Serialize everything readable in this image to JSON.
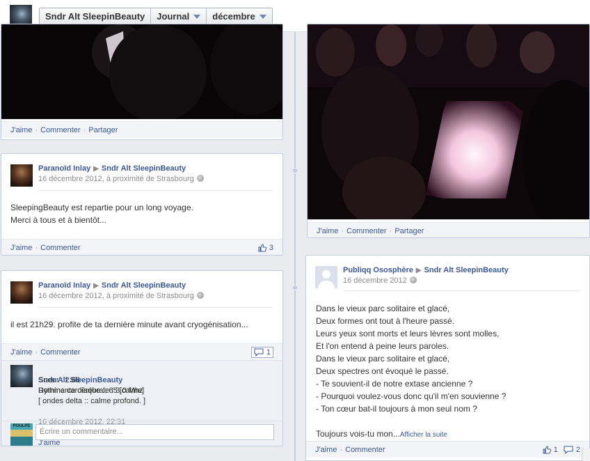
{
  "header": {
    "page_name": "Sndr Alt SleepinBeauty",
    "section": "Journal",
    "month": "décembre"
  },
  "actions": {
    "like": "J'aime",
    "comment": "Commenter",
    "share": "Partager",
    "sep": "·"
  },
  "left_photo_post": {},
  "post1": {
    "author": "Paranoïd Inlay",
    "target": "Sndr Alt SleepinBeauty",
    "date": "16 décembre 2012, à proximité de Strasbourg",
    "text": "SleepingBeauty est repartie pour un long voyage.\nMerci à tous et à bientôt...",
    "likes": "3"
  },
  "post2": {
    "author": "Paranoïd Inlay",
    "target": "Sndr Alt SleepinBeauty",
    "date": "16 décembre 2012, à proximité de Strasbourg",
    "text": "il est 21h29. profite de ta dernière minute avant cryogénisation...",
    "comments_count": "1",
    "comment": {
      "author": "Sndr Alt SleepinBeauty",
      "first_line": "Rythme cardiaque :: 65 [calme]",
      "body": "Sueur : 2.66\nDominante cérébrale : 3.0 Mhz\n[ ondes delta :: calme profond. ]",
      "date": "16 décembre 2012, 22:31",
      "like": "J'aime"
    },
    "commenter_badge": "POULPE",
    "input_placeholder": "Écrire un commentaire..."
  },
  "right_photo_post": {},
  "post3": {
    "author": "Publiqq Ososphère",
    "target": "Sndr Alt SleepinBeauty",
    "date": "16 décembre 2012",
    "text": "Dans le vieux parc solitaire et glacé,\nDeux formes ont tout à l'heure passé.\nLeurs yeux sont morts et leurs lèvres sont molles,\nEt l'on entend à peine leurs paroles.\nDans le vieux parc solitaire et glacé,\nDeux spectres ont évoqué le passé.\n- Te souvient-il de notre extase ancienne ?\n- Pourquoi voulez-vous donc qu'il m'en souvienne ?\n- Ton cœur bat-il toujours à mon seul nom ?",
    "last_line": "Toujours vois-tu mon...",
    "see_more": "Afficher la suite",
    "likes": "1",
    "comments": "2"
  },
  "colors": {
    "link": "#3b5998",
    "meta": "#8c8c8c",
    "border": "#c4cde0",
    "action_bar": "#f2f4f8"
  }
}
